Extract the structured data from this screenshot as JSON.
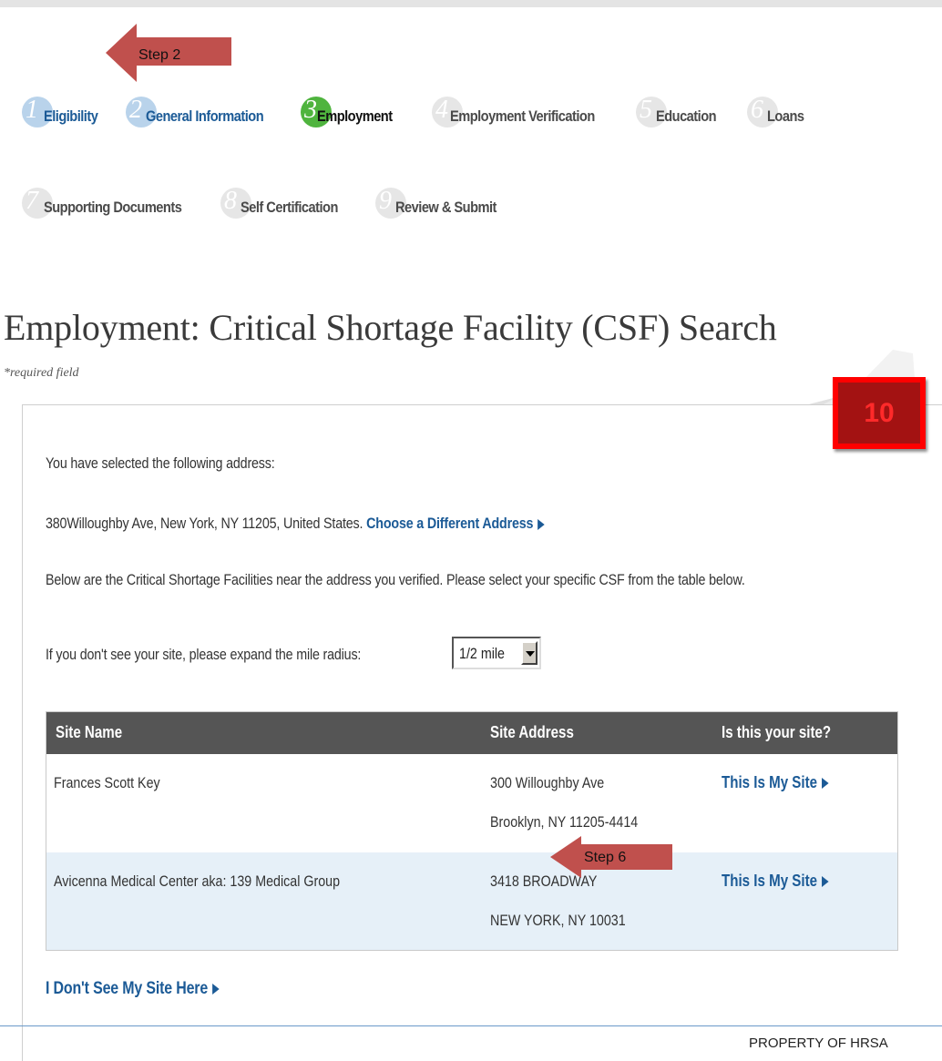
{
  "steps": [
    {
      "num": "1",
      "label": "Eligibility",
      "state": "done"
    },
    {
      "num": "2",
      "label": "General Information",
      "state": "done"
    },
    {
      "num": "3",
      "label": "Employment",
      "state": "current"
    },
    {
      "num": "4",
      "label": "Employment Verification",
      "state": "todo"
    },
    {
      "num": "5",
      "label": "Education",
      "state": "todo"
    },
    {
      "num": "6",
      "label": "Loans",
      "state": "todo"
    },
    {
      "num": "7",
      "label": "Supporting Documents",
      "state": "todo"
    },
    {
      "num": "8",
      "label": "Self Certification",
      "state": "todo"
    },
    {
      "num": "9",
      "label": "Review & Submit",
      "state": "todo"
    }
  ],
  "callouts": {
    "step2": "Step 2",
    "step6": "Step 6"
  },
  "callout_color": "#c0504d",
  "page": {
    "title": "Employment: Critical Shortage Facility (CSF) Search",
    "required_note": "*required field",
    "badge": "10"
  },
  "content": {
    "selected_intro": "You have selected the following address:",
    "address": "380Willoughby Ave, New York, NY 11205, United States.",
    "change_address_link": "Choose a Different Address",
    "below_text": "Below are the Critical Shortage Facilities near the address you verified. Please select your specific CSF from the table below.",
    "radius_prompt": "If you don't see your site, please expand the mile radius:",
    "radius_value": "1/2 mile",
    "not_listed_link": "I Don't See My Site Here"
  },
  "table": {
    "headers": [
      "Site Name",
      "Site Address",
      "Is this your site?"
    ],
    "rows": [
      {
        "name": "Frances Scott Key",
        "address1": "300 Willoughby Ave",
        "address2": "Brooklyn, NY 11205-4414",
        "action": "This Is My Site"
      },
      {
        "name": "Avicenna Medical Center aka: 139 Medical Group",
        "address1": "3418 BROADWAY",
        "address2": "NEW YORK, NY 10031",
        "action": "This Is My Site"
      }
    ]
  },
  "footer": "PROPERTY OF HRSA",
  "colors": {
    "link_blue": "#1b5a96",
    "table_header": "#555555",
    "row_alt": "#e6f0f8",
    "current_step": "#4fb43e",
    "done_step": "#b9d3eb",
    "badge_red": "#ff0000"
  }
}
